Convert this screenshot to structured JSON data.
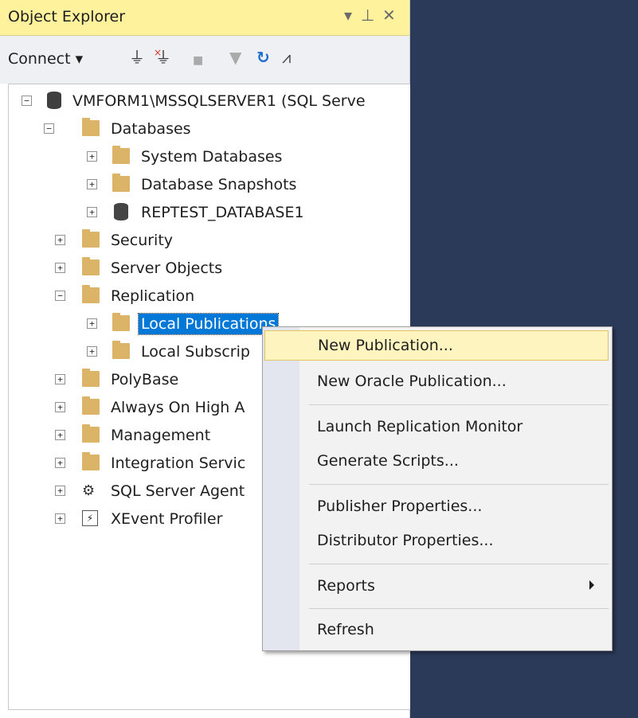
{
  "panel": {
    "title": "Object Explorer",
    "pin_glyph": "▾ ᵒ ✕"
  },
  "toolbar": {
    "connect_label": "Connect ▾",
    "icons": [
      "connect-plug-icon",
      "disconnect-plug-icon",
      "stop-icon",
      "filter-icon",
      "refresh-icon",
      "activity-monitor-icon"
    ]
  },
  "tree": {
    "server": "VMFORM1\\MSSQLSERVER1 (SQL Serve",
    "databases": "Databases",
    "system_databases": "System Databases",
    "database_snapshots": "Database Snapshots",
    "reptest_database": "REPTEST_DATABASE1",
    "security": "Security",
    "server_objects": "Server Objects",
    "replication": "Replication",
    "local_publications": "Local Publications",
    "local_subscriptions": "Local Subscrip",
    "polybase": "PolyBase",
    "always_on": "Always On High A",
    "management": "Management",
    "integration_services": "Integration Servic",
    "sql_server_agent": "SQL Server Agent",
    "xevent_profiler": "XEvent Profiler",
    "expand_sign": "+",
    "collapse_sign": "−"
  },
  "context_menu": {
    "new_publication": "New Publication...",
    "new_oracle_publication": "New Oracle Publication...",
    "launch_replication_monitor": "Launch Replication Monitor",
    "generate_scripts": "Generate Scripts...",
    "publisher_properties": "Publisher Properties...",
    "distributor_properties": "Distributor Properties...",
    "reports": "Reports",
    "refresh": "Refresh"
  },
  "colors": {
    "title_bar": "#fff29d",
    "selection": "#0078d7",
    "menu_highlight": "#fdf4bf",
    "background": "#2c3a5a"
  }
}
